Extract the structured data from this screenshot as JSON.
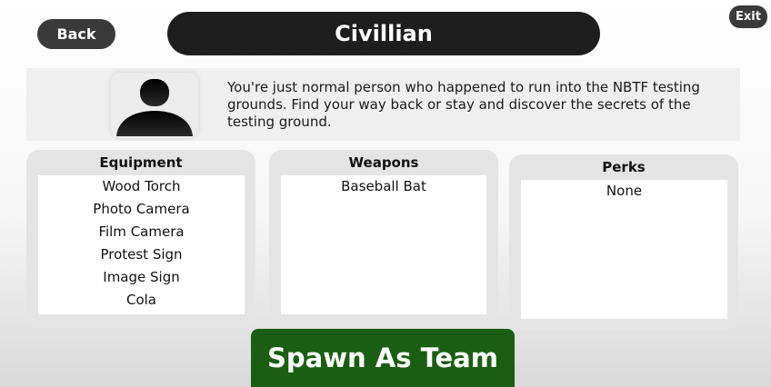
{
  "header": {
    "back_label": "Back",
    "title": "Civillian",
    "exit_label": "Exit"
  },
  "team": {
    "avatar_icon": "person-silhouette-icon",
    "description": "You're just normal person who happened to run into the NBTF testing grounds. Find your way back or stay and discover the secrets of the testing ground."
  },
  "equipment": {
    "title": "Equipment",
    "items": [
      "Wood Torch",
      "Photo Camera",
      "Film Camera",
      "Protest Sign",
      "Image Sign",
      "Cola"
    ]
  },
  "weapons": {
    "title": "Weapons",
    "items": [
      "Baseball Bat"
    ]
  },
  "perks": {
    "title": "Perks",
    "items": [
      "None"
    ]
  },
  "spawn_label": "Spawn As Team",
  "colors": {
    "title_bar": "#1e1e1e",
    "spawn_button": "#1b5e13",
    "panel": "#e4e4e4"
  }
}
